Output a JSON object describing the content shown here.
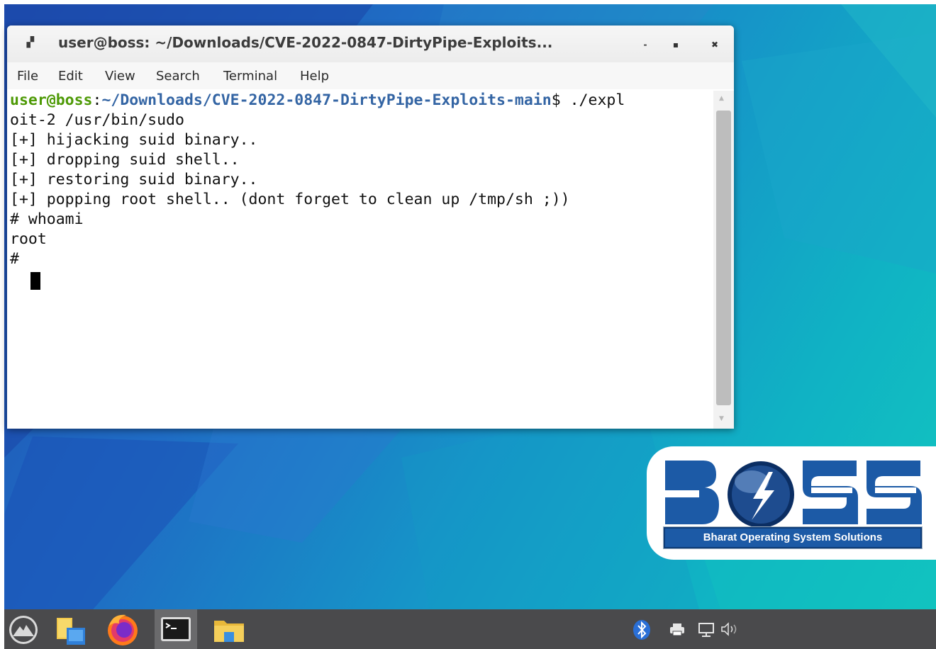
{
  "window": {
    "title": "user@boss: ~/Downloads/CVE-2022-0847-DirtyPipe-Exploits...",
    "controls": {
      "minimize": "-",
      "maximize": "▪",
      "close": "✖"
    }
  },
  "menu": {
    "items": [
      "File",
      "Edit",
      "View",
      "Search",
      "Terminal",
      "Help"
    ]
  },
  "terminal": {
    "prompt_user": "user@boss",
    "prompt_sep": ":",
    "prompt_path": "~/Downloads/CVE-2022-0847-DirtyPipe-Exploits-main",
    "prompt_suffix": "$ ./expl",
    "lines": [
      "oit-2 /usr/bin/sudo",
      "[+] hijacking suid binary..",
      "[+] dropping suid shell..",
      "[+] restoring suid binary..",
      "[+] popping root shell.. (dont forget to clean up /tmp/sh ;))",
      "# whoami",
      "root",
      "# "
    ]
  },
  "logo": {
    "caption": "Bharat Operating System Solutions",
    "brand_color": "#1c5aa6"
  },
  "taskbar": {
    "apps": [
      {
        "name": "menu",
        "icon": "mountain-icon"
      },
      {
        "name": "file-manager",
        "icon": "file-manager-icon"
      },
      {
        "name": "firefox",
        "icon": "firefox-icon"
      },
      {
        "name": "terminal",
        "icon": "terminal-icon",
        "active": true
      },
      {
        "name": "files",
        "icon": "folder-icon"
      }
    ],
    "tray": [
      "bluetooth-icon",
      "printer-icon",
      "network-icon",
      "volume-icon"
    ]
  }
}
